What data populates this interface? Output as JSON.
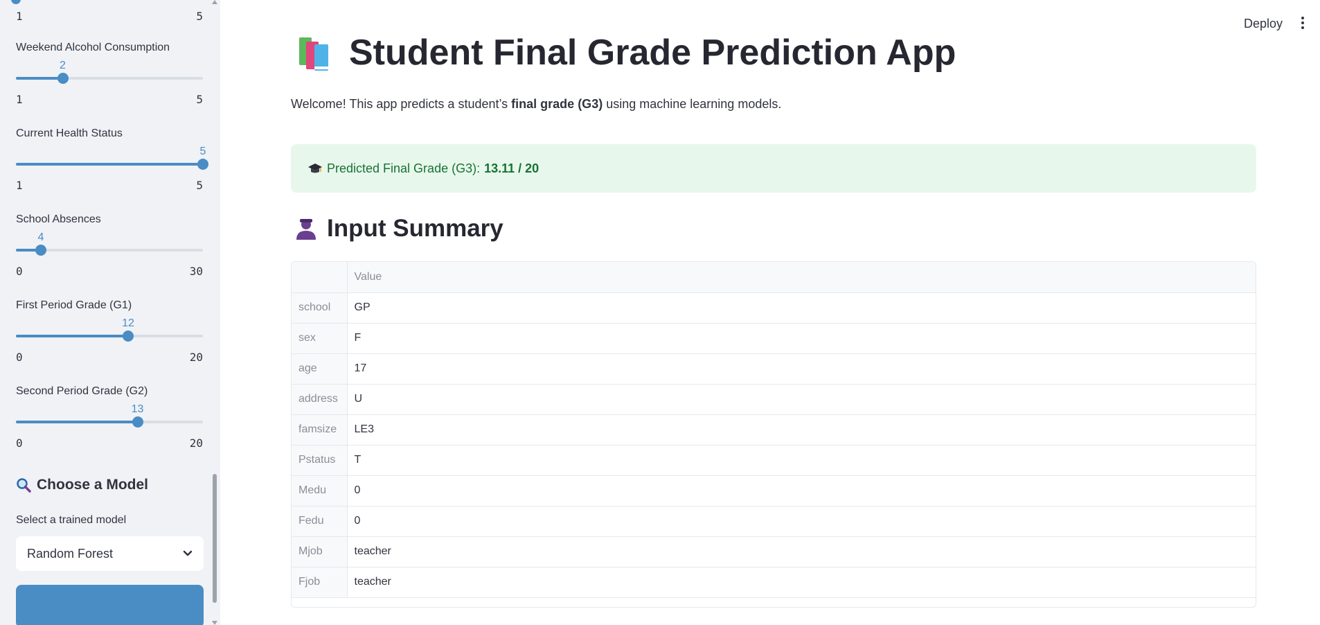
{
  "sidebar": {
    "top_slider": {
      "min": "1",
      "max": "5"
    },
    "sliders": [
      {
        "label": "Weekend Alcohol Consumption",
        "value": "2",
        "min": "1",
        "max": "5",
        "fraction": 0.25
      },
      {
        "label": "Current Health Status",
        "value": "5",
        "min": "1",
        "max": "5",
        "fraction": 1.0
      },
      {
        "label": "School Absences",
        "value": "4",
        "min": "0",
        "max": "30",
        "fraction": 0.1333
      },
      {
        "label": "First Period Grade (G1)",
        "value": "12",
        "min": "0",
        "max": "20",
        "fraction": 0.6
      },
      {
        "label": "Second Period Grade (G2)",
        "value": "13",
        "min": "0",
        "max": "20",
        "fraction": 0.65
      }
    ],
    "model_section": {
      "title": "Choose a Model",
      "select_label": "Select a trained model",
      "selected_model": "Random Forest"
    }
  },
  "header": {
    "deploy_label": "Deploy"
  },
  "main": {
    "title": "Student Final Grade Prediction App",
    "welcome_prefix": "Welcome! This app predicts a student’s ",
    "welcome_bold": "final grade (G3)",
    "welcome_suffix": " using machine learning models.",
    "prediction_label": "Predicted Final Grade (G3): ",
    "prediction_value": "13.11 / 20",
    "summary_title": "Input Summary",
    "table_header": "Value",
    "rows": [
      {
        "key": "school",
        "value": "GP"
      },
      {
        "key": "sex",
        "value": "F"
      },
      {
        "key": "age",
        "value": "17"
      },
      {
        "key": "address",
        "value": "U"
      },
      {
        "key": "famsize",
        "value": "LE3"
      },
      {
        "key": "Pstatus",
        "value": "T"
      },
      {
        "key": "Medu",
        "value": "0"
      },
      {
        "key": "Fedu",
        "value": "0"
      },
      {
        "key": "Mjob",
        "value": "teacher"
      },
      {
        "key": "Fjob",
        "value": "teacher"
      }
    ]
  },
  "colors": {
    "accent": "#4a8cc4",
    "success_bg": "#e8f7ec",
    "success_text": "#177233",
    "sidebar_bg": "#f0f2f6"
  },
  "icons": {
    "title_icon": "books-icon",
    "graduation_icon": "graduation-cap-icon",
    "summary_icon": "person-silhouette-icon",
    "model_icon": "magnifier-icon"
  }
}
